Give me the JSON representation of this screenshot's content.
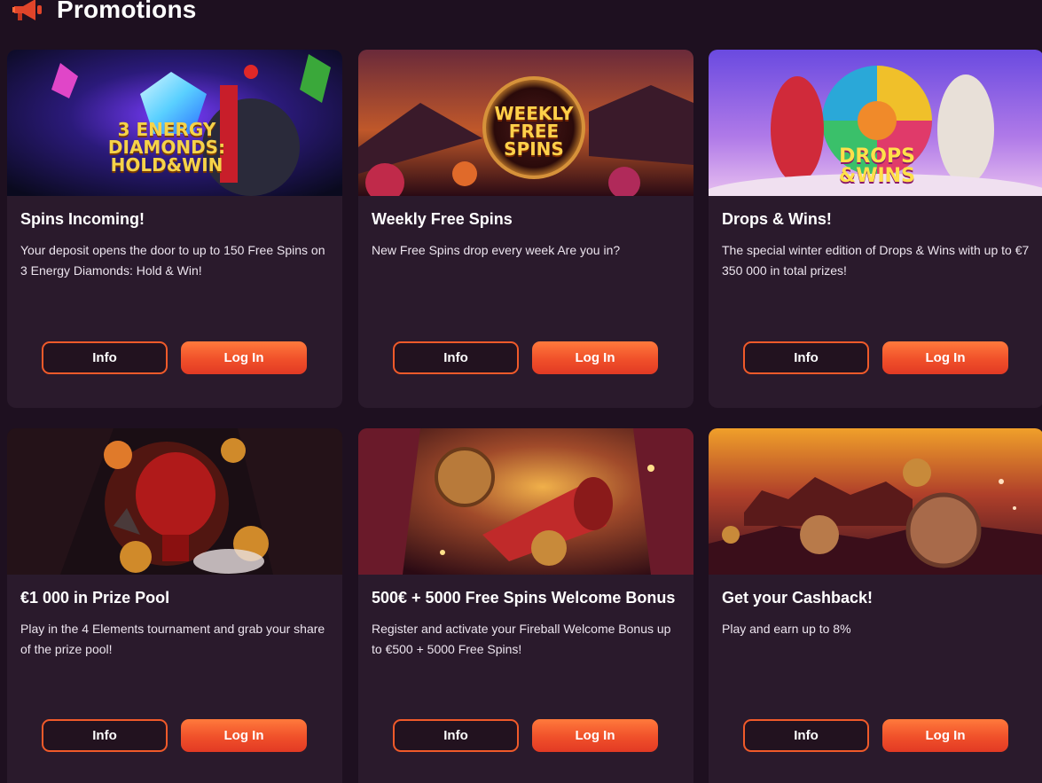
{
  "header": {
    "title": "Promotions",
    "icon": "megaphone-icon"
  },
  "colors": {
    "background": "#1e1020",
    "card": "#2a1a2c",
    "accent": "#f05a2a"
  },
  "promotions": [
    {
      "title": "Spins Incoming!",
      "description": "Your deposit opens the door to up to 150 Free Spins on 3 Energy Diamonds: Hold & Win!",
      "image_caption": "3 ENERGY DIAMONDS: HOLD&WIN",
      "info_label": "Info",
      "login_label": "Log In"
    },
    {
      "title": "Weekly Free Spins",
      "description": "New Free Spins drop every week Are you in?",
      "image_caption": "WEEKLY FREE SPINS",
      "info_label": "Info",
      "login_label": "Log In"
    },
    {
      "title": "Drops & Wins!",
      "description": "The special winter edition of Drops & Wins with up to €7 350 000 in total prizes!",
      "image_caption": "DROPS &WINS",
      "info_label": "Info",
      "login_label": "Log In"
    },
    {
      "title": "€1 000 in Prize Pool",
      "description": "Play in the 4 Elements tournament and grab your share of the prize pool!",
      "image_caption": "",
      "info_label": "Info",
      "login_label": "Log In"
    },
    {
      "title": "500€ + 5000 Free Spins Welcome Bonus",
      "description": "Register and activate your Fireball Welcome Bonus up to €500 + 5000 Free Spins!",
      "image_caption": "",
      "info_label": "Info",
      "login_label": "Log In"
    },
    {
      "title": "Get your Cashback!",
      "description": "Play and earn up to 8%",
      "image_caption": "",
      "info_label": "Info",
      "login_label": "Log In"
    }
  ]
}
